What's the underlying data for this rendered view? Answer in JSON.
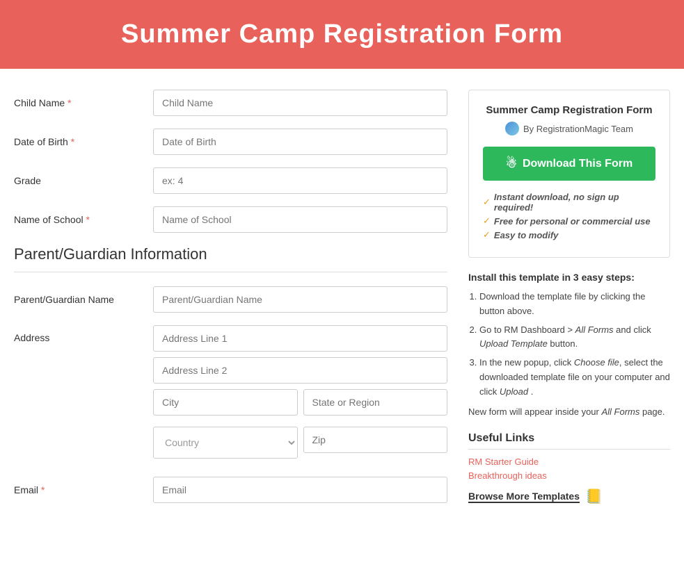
{
  "header": {
    "title": "Summer Camp Registration Form"
  },
  "form": {
    "fields": [
      {
        "label": "Child Name",
        "required": true,
        "placeholder": "Child Name",
        "type": "text"
      },
      {
        "label": "Date of Birth",
        "required": true,
        "placeholder": "Date of Birth",
        "type": "text"
      },
      {
        "label": "Grade",
        "required": false,
        "placeholder": "ex: 4",
        "type": "text"
      },
      {
        "label": "Name of School",
        "required": true,
        "placeholder": "Name of School",
        "type": "text"
      }
    ],
    "section_heading": "Parent/Guardian Information",
    "guardian_fields": [
      {
        "label": "Parent/Guardian Name",
        "required": false,
        "placeholder": "Parent/Guardian Name",
        "type": "text"
      }
    ],
    "address": {
      "label": "Address",
      "line1_placeholder": "Address Line 1",
      "line2_placeholder": "Address Line 2",
      "city_placeholder": "City",
      "state_placeholder": "State or Region",
      "country_placeholder": "Country",
      "zip_placeholder": "Zip"
    },
    "email": {
      "label": "Email",
      "required": true,
      "placeholder": "Email"
    }
  },
  "sidebar": {
    "card": {
      "title": "Summer Camp Registration Form",
      "author": "By RegistrationMagic Team",
      "download_button": "Download This Form",
      "features": [
        "Instant download, no sign up required!",
        "Free for personal or commercial use",
        "Easy to modify"
      ]
    },
    "install": {
      "title": "Install this template in 3 easy steps:",
      "steps": [
        "Download the template file by clicking the button above.",
        "Go to RM Dashboard > All Forms and click Upload Template button.",
        "In the new popup, click  Choose file, select the downloaded template file on your computer and click  Upload ."
      ],
      "note": "New form will appear inside your All Forms page."
    },
    "useful_links": {
      "title": "Useful Links",
      "links": [
        {
          "text": "RM Starter Guide",
          "href": "#"
        },
        {
          "text": "Breakthrough ideas",
          "href": "#"
        }
      ],
      "browse_label": "Browse More Templates"
    }
  }
}
